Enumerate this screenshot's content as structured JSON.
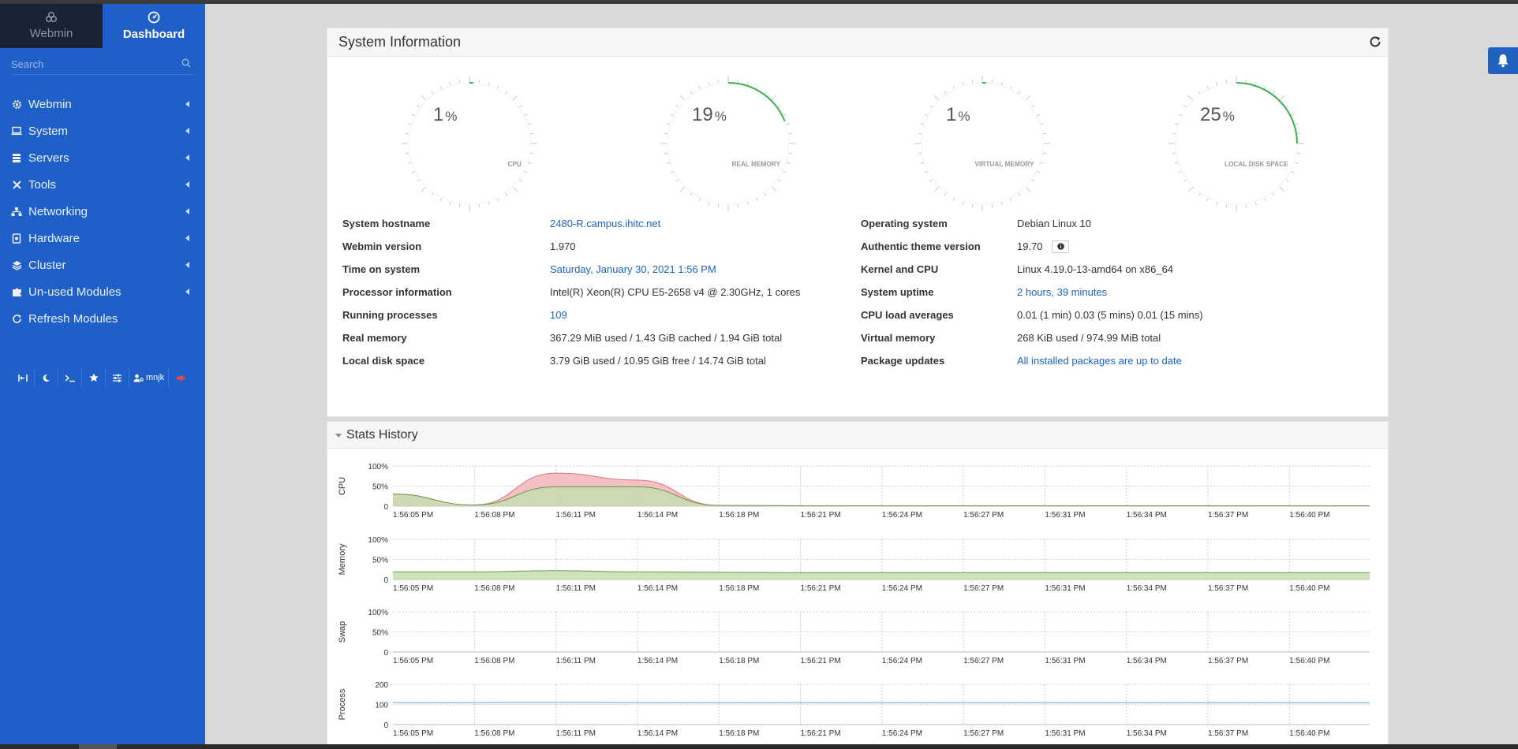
{
  "sidebar": {
    "tabs": [
      {
        "label": "Webmin",
        "icon": "webmin-logo-icon"
      },
      {
        "label": "Dashboard",
        "icon": "dashboard-gauge-icon"
      }
    ],
    "search_placeholder": "Search",
    "menu": [
      {
        "label": "Webmin",
        "icon": "gear-icon"
      },
      {
        "label": "System",
        "icon": "laptop-icon"
      },
      {
        "label": "Servers",
        "icon": "server-icon"
      },
      {
        "label": "Tools",
        "icon": "tools-icon"
      },
      {
        "label": "Networking",
        "icon": "network-icon"
      },
      {
        "label": "Hardware",
        "icon": "hardware-icon"
      },
      {
        "label": "Cluster",
        "icon": "layers-icon"
      },
      {
        "label": "Un-used Modules",
        "icon": "puzzle-icon"
      },
      {
        "label": "Refresh Modules",
        "icon": "refresh-icon"
      }
    ],
    "tools_user": "mnjk"
  },
  "sysinfo": {
    "title": "System Information",
    "gauges": [
      {
        "value": "1",
        "unit": "%",
        "label": "CPU",
        "fraction": 0.01
      },
      {
        "value": "19",
        "unit": "%",
        "label": "REAL MEMORY",
        "fraction": 0.19
      },
      {
        "value": "1",
        "unit": "%",
        "label": "VIRTUAL MEMORY",
        "fraction": 0.01
      },
      {
        "value": "25",
        "unit": "%",
        "label": "LOCAL DISK SPACE",
        "fraction": 0.25
      }
    ],
    "left": [
      {
        "key": "System hostname",
        "value": "2480-R.campus.ihitc.net",
        "link": true
      },
      {
        "key": "Webmin version",
        "value": "1.970",
        "link": false
      },
      {
        "key": "Time on system",
        "value": "Saturday, January 30, 2021 1:56 PM",
        "link": true
      },
      {
        "key": "Processor information",
        "value": "Intel(R) Xeon(R) CPU E5-2658 v4 @ 2.30GHz, 1 cores",
        "link": false
      },
      {
        "key": "Running processes",
        "value": "109",
        "link": true
      },
      {
        "key": "Real memory",
        "value": "367.29 MiB used / 1.43 GiB cached / 1.94 GiB total",
        "link": false
      },
      {
        "key": "Local disk space",
        "value": "3.79 GiB used / 10.95 GiB free / 14.74 GiB total",
        "link": false
      }
    ],
    "right": [
      {
        "key": "Operating system",
        "value": "Debian Linux 10",
        "link": false
      },
      {
        "key": "Authentic theme version",
        "value": "19.70",
        "link": false
      },
      {
        "key": "Kernel and CPU",
        "value": "Linux 4.19.0-13-amd64 on x86_64",
        "link": false
      },
      {
        "key": "System uptime",
        "value": "2 hours, 39 minutes",
        "link": true
      },
      {
        "key": "CPU load averages",
        "value": "0.01 (1 min) 0.03 (5 mins) 0.01 (15 mins)",
        "link": false
      },
      {
        "key": "Virtual memory",
        "value": "268 KiB used / 974.99 MiB total",
        "link": false
      },
      {
        "key": "Package updates",
        "value": "All installed packages are up to date",
        "link": true
      }
    ]
  },
  "stats": {
    "title": "Stats History"
  },
  "chart_data": [
    {
      "type": "area",
      "ylabel": "CPU",
      "yticks": [
        "100%",
        "50%",
        "0"
      ],
      "x": [
        "1:56:05 PM",
        "1:56:08 PM",
        "1:56:11 PM",
        "1:56:14 PM",
        "1:56:18 PM",
        "1:56:21 PM",
        "1:56:24 PM",
        "1:56:27 PM",
        "1:56:31 PM",
        "1:56:34 PM",
        "1:56:37 PM",
        "1:56:40 PM"
      ],
      "ylim": [
        0,
        100
      ],
      "series": [
        {
          "color": "#f3b5b8",
          "values": [
            30,
            3,
            82,
            65,
            2,
            1,
            1,
            1,
            1,
            1,
            1,
            1,
            1
          ]
        },
        {
          "color": "#c5ddb0",
          "values": [
            30,
            3,
            48,
            48,
            2,
            1,
            1,
            1,
            1,
            1,
            1,
            1,
            1
          ]
        }
      ]
    },
    {
      "type": "area",
      "ylabel": "Memory",
      "yticks": [
        "100%",
        "50%",
        "0"
      ],
      "x": [
        "1:56:05 PM",
        "1:56:08 PM",
        "1:56:11 PM",
        "1:56:14 PM",
        "1:56:18 PM",
        "1:56:21 PM",
        "1:56:24 PM",
        "1:56:27 PM",
        "1:56:31 PM",
        "1:56:34 PM",
        "1:56:37 PM",
        "1:56:40 PM"
      ],
      "ylim": [
        0,
        100
      ],
      "series": [
        {
          "color": "#c5ddb0",
          "values": [
            19,
            19,
            22,
            19,
            18,
            17,
            17,
            17,
            17,
            17,
            17,
            17,
            17
          ]
        }
      ]
    },
    {
      "type": "area",
      "ylabel": "Swap",
      "yticks": [
        "100%",
        "50%",
        "0"
      ],
      "x": [
        "1:56:05 PM",
        "1:56:08 PM",
        "1:56:11 PM",
        "1:56:14 PM",
        "1:56:18 PM",
        "1:56:21 PM",
        "1:56:24 PM",
        "1:56:27 PM",
        "1:56:31 PM",
        "1:56:34 PM",
        "1:56:37 PM",
        "1:56:40 PM"
      ],
      "ylim": [
        0,
        100
      ],
      "series": []
    },
    {
      "type": "line",
      "ylabel": "Process",
      "yticks": [
        "200",
        "100",
        "0"
      ],
      "x": [
        "1:56:05 PM",
        "1:56:08 PM",
        "1:56:11 PM",
        "1:56:14 PM",
        "1:56:18 PM",
        "1:56:21 PM",
        "1:56:24 PM",
        "1:56:27 PM",
        "1:56:31 PM",
        "1:56:34 PM",
        "1:56:37 PM",
        "1:56:40 PM"
      ],
      "ylim": [
        0,
        200
      ],
      "series": [
        {
          "color": "#6a9fd8",
          "values": [
            109,
            109,
            110,
            109,
            109,
            109,
            109,
            109,
            109,
            109,
            109,
            109,
            109
          ]
        }
      ]
    }
  ]
}
